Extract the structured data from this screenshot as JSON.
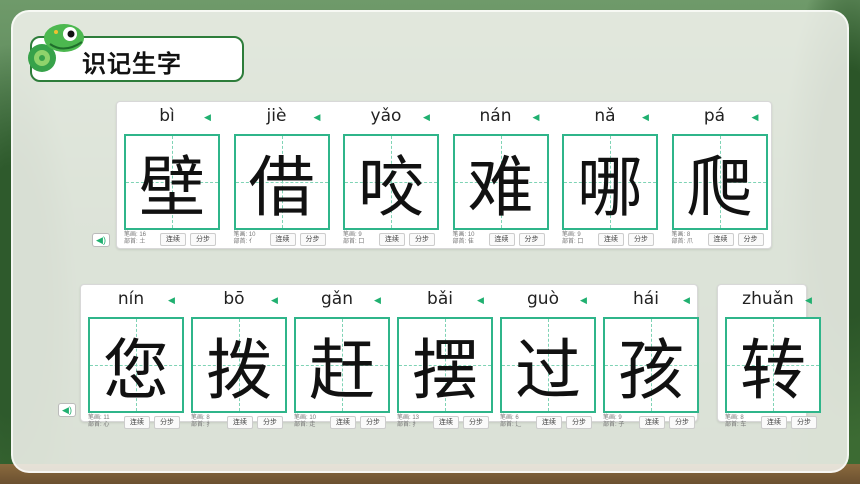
{
  "header": {
    "title": "识记生字"
  },
  "row1": [
    {
      "pinyin": "bì",
      "char": "壁",
      "strokes": "笔画: 16",
      "radical": "部首: 土"
    },
    {
      "pinyin": "jiè",
      "char": "借",
      "strokes": "笔画: 10",
      "radical": "部首: 亻"
    },
    {
      "pinyin": "yǎo",
      "char": "咬",
      "strokes": "笔画: 9",
      "radical": "部首: 口"
    },
    {
      "pinyin": "nán",
      "char": "难",
      "strokes": "笔画: 10",
      "radical": "部首: 隹"
    },
    {
      "pinyin": "nǎ",
      "char": "哪",
      "strokes": "笔画: 9",
      "radical": "部首: 口"
    },
    {
      "pinyin": "pá",
      "char": "爬",
      "strokes": "笔画: 8",
      "radical": "部首: 爪"
    }
  ],
  "row2": [
    {
      "pinyin": "nín",
      "char": "您",
      "strokes": "笔画: 11",
      "radical": "部首: 心"
    },
    {
      "pinyin": "bō",
      "char": "拨",
      "strokes": "笔画: 8",
      "radical": "部首: 扌"
    },
    {
      "pinyin": "gǎn",
      "char": "赶",
      "strokes": "笔画: 10",
      "radical": "部首: 走"
    },
    {
      "pinyin": "bǎi",
      "char": "摆",
      "strokes": "笔画: 13",
      "radical": "部首: 扌"
    },
    {
      "pinyin": "guò",
      "char": "过",
      "strokes": "笔画: 6",
      "radical": "部首: 辶"
    },
    {
      "pinyin": "hái",
      "char": "孩",
      "strokes": "笔画: 9",
      "radical": "部首: 子"
    }
  ],
  "row3": [
    {
      "pinyin": "zhuǎn",
      "char": "转",
      "strokes": "笔画: 8",
      "radical": "部首: 车"
    }
  ],
  "buttons": {
    "continuous": "连续",
    "step": "分步"
  },
  "icons": {
    "speaker": "speaker-icon",
    "mascot": "chameleon-mascot"
  },
  "colors": {
    "accent": "#2fb58a",
    "title_border": "#2d7d3a",
    "speaker": "#20b070"
  }
}
